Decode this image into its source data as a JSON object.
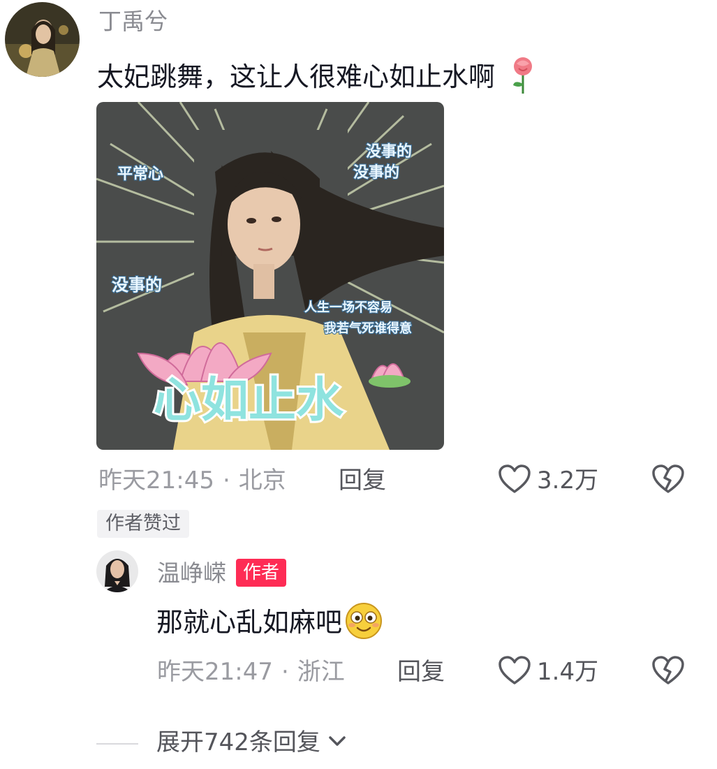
{
  "comment": {
    "username": "丁禹兮",
    "text": "太妃跳舞，这让人很难心如止水啊",
    "emoji": "rose-emoji",
    "meme": {
      "labels": [
        "平常心",
        "没事的",
        "没事的",
        "没事的",
        "人生一场不容易",
        "我若气死谁得意"
      ],
      "big_text": "心如止水"
    },
    "time": "昨天21:45",
    "separator": "·",
    "location": "北京",
    "reply_label": "回复",
    "like_count": "3.2万",
    "liked_tag": "作者赞过"
  },
  "reply": {
    "username": "温峥嵘",
    "author_tag": "作者",
    "text": "那就心乱如麻吧",
    "emoji": "smiling-face-emoji",
    "time": "昨天21:47",
    "separator": "·",
    "location": "浙江",
    "reply_label": "回复",
    "like_count": "1.4万"
  },
  "expand": {
    "label": "展开742条回复"
  },
  "colors": {
    "accent": "#fe2c55",
    "muted": "#9a9ba1",
    "meme_bg": "#4a4c4b",
    "meme_robe": "#e9d38a"
  }
}
